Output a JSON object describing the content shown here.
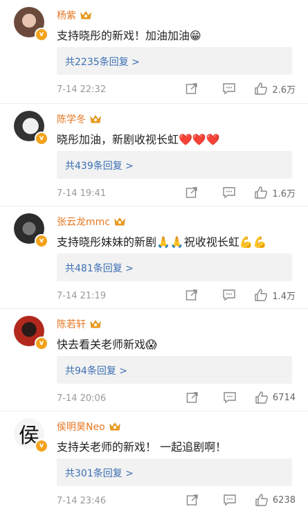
{
  "comments": [
    {
      "name": "杨紫",
      "text": "支持晓彤的新戏！加油加油😁",
      "reply_link": "共2235条回复 >",
      "date": "7-14 22:32",
      "likes": "2.6万",
      "avatar_color": "#b88a79"
    },
    {
      "name": "陈学冬",
      "text": "晓彤加油，新剧收视长虹❤️❤️❤️",
      "reply_link": "共439条回复 >",
      "date": "7-14 19:41",
      "likes": "1.6万",
      "avatar_color": "#d8d8d8"
    },
    {
      "name": "张云龙mmc",
      "text": "支持晓彤妹妹的新剧🙏🙏祝收视长虹💪💪",
      "reply_link": "共481条回复 >",
      "date": "7-14 21:19",
      "likes": "1.4万",
      "avatar_color": "#4a4a4a"
    },
    {
      "name": "陈若轩",
      "text": "快去看关老师新戏😱",
      "reply_link": "共94条回复 >",
      "date": "7-14 20:06",
      "likes": "6714",
      "avatar_color": "#b2281d"
    },
    {
      "name": "侯明昊Neo",
      "text": "支持关老师的新戏！ 一起追剧啊！",
      "reply_link": "共301条回复 >",
      "date": "7-14 23:46",
      "likes": "6238",
      "avatar_color": "#f5f5f5",
      "avatar_glyph": "侯"
    }
  ],
  "icons": {
    "share": "share-icon",
    "comment": "comment-icon",
    "like": "like-icon",
    "verified": "verified-badge-icon",
    "crown": "vip-crown-icon"
  },
  "colors": {
    "name": "#e7761f",
    "reply_link": "#3b6fb3",
    "meta": "#999999"
  }
}
